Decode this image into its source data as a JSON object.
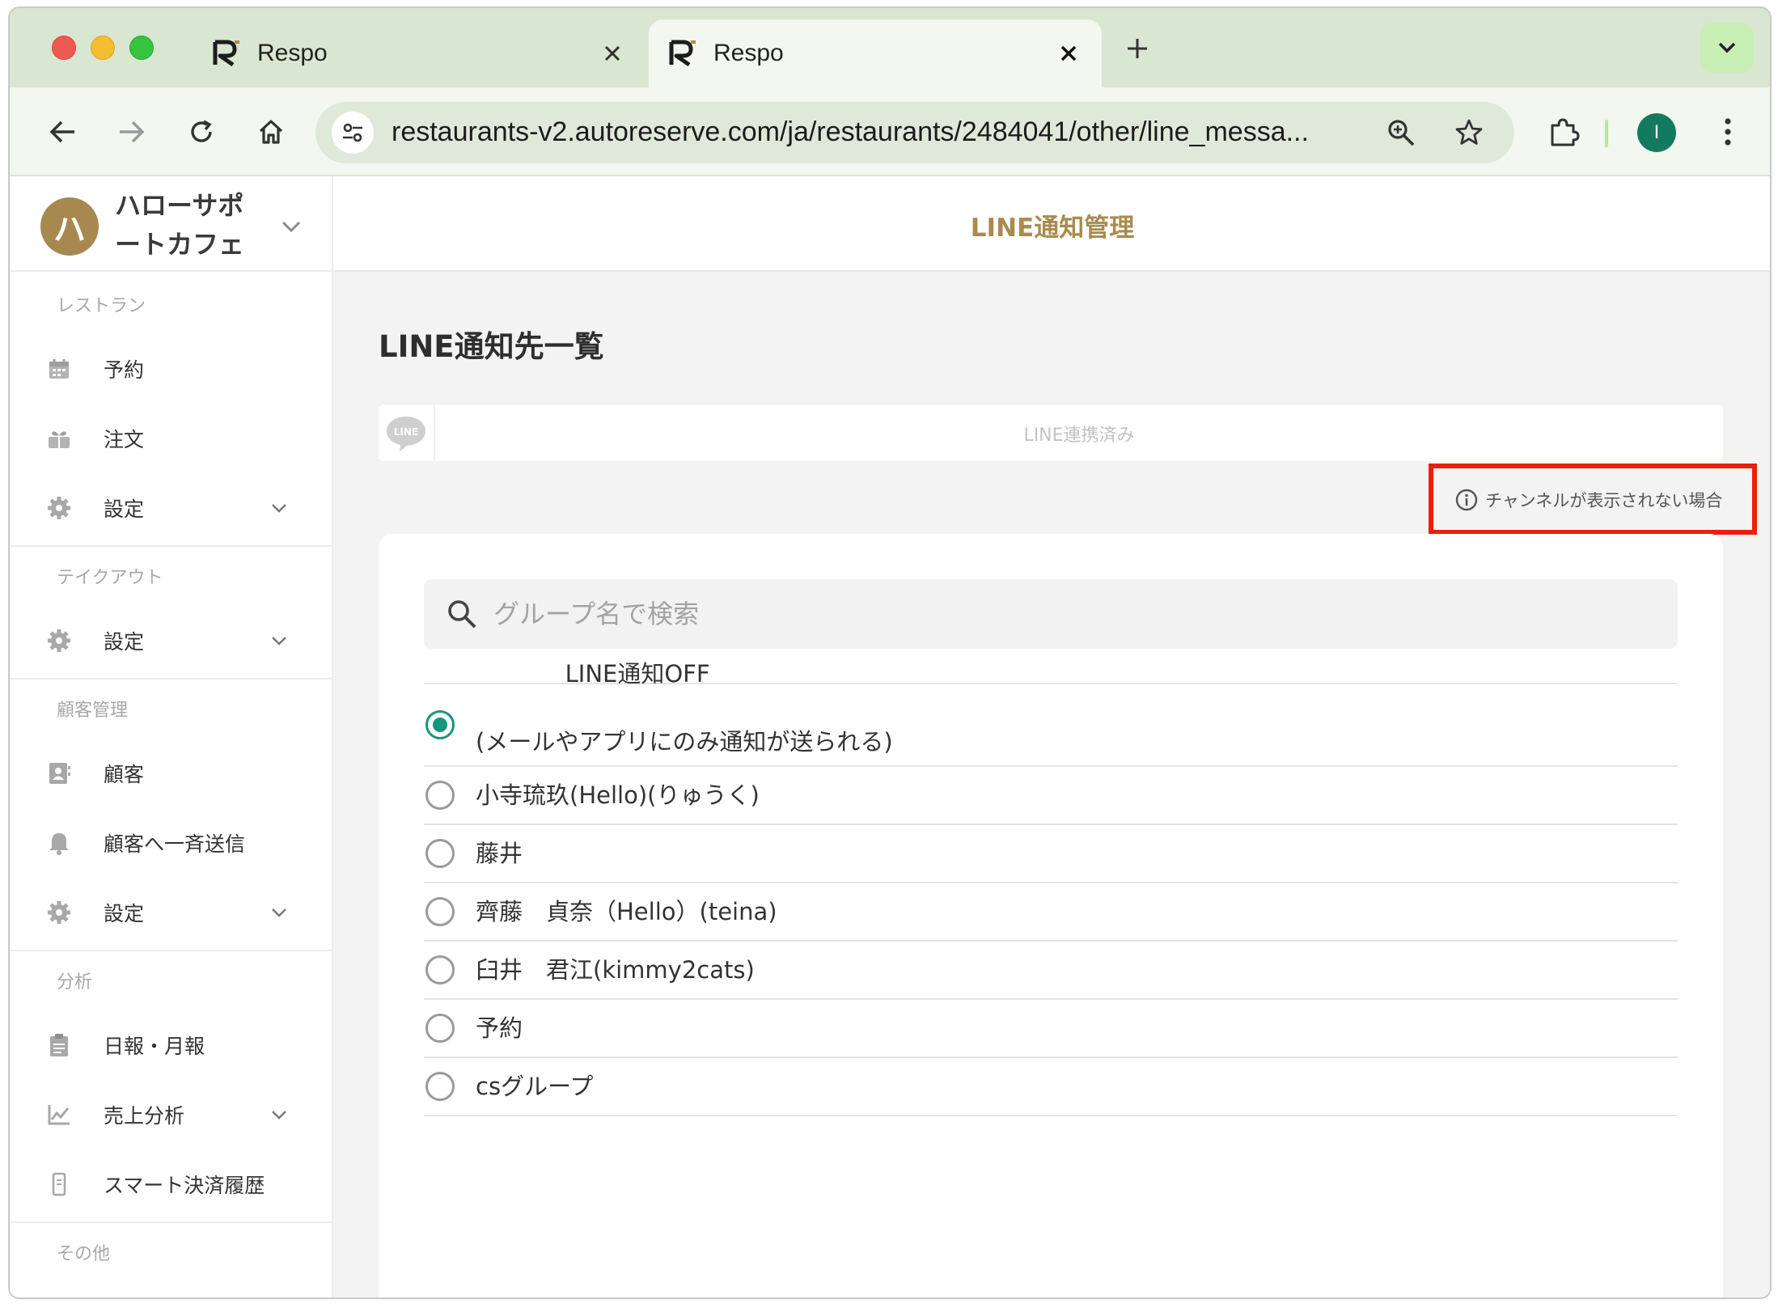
{
  "browser": {
    "tabs": [
      {
        "title": "Respo",
        "active": false
      },
      {
        "title": "Respo",
        "active": true
      }
    ],
    "url": "restaurants-v2.autoreserve.com/ja/restaurants/2484041/other/line_messa...",
    "profile_initial": "I"
  },
  "sidebar": {
    "store_avatar": "ハ",
    "store_name": "ハローサポートカフェ",
    "sections": [
      {
        "label": "レストラン",
        "items": [
          {
            "label": "予約",
            "icon": "calendar-icon"
          },
          {
            "label": "注文",
            "icon": "gift-icon"
          },
          {
            "label": "設定",
            "icon": "gear-icon",
            "has_chevron": true
          }
        ]
      },
      {
        "label": "テイクアウト",
        "items": [
          {
            "label": "設定",
            "icon": "gear-icon",
            "has_chevron": true
          }
        ]
      },
      {
        "label": "顧客管理",
        "items": [
          {
            "label": "顧客",
            "icon": "contact-book-icon"
          },
          {
            "label": "顧客へ一斉送信",
            "icon": "bell-icon"
          },
          {
            "label": "設定",
            "icon": "gear-icon",
            "has_chevron": true
          }
        ]
      },
      {
        "label": "分析",
        "items": [
          {
            "label": "日報・月報",
            "icon": "clipboard-icon"
          },
          {
            "label": "売上分析",
            "icon": "line-chart-icon",
            "has_chevron": true
          },
          {
            "label": "スマート決済履歴",
            "icon": "phone-receipt-icon"
          }
        ]
      },
      {
        "label": "その他",
        "items": []
      }
    ]
  },
  "main": {
    "header_title": "LINE通知管理",
    "page_title": "LINE通知先一覧",
    "line_logo_text": "LINE",
    "line_status": "LINE連携済み",
    "help_link": "チャンネルが表示されない場合",
    "search_placeholder": "グループ名で検索",
    "options": [
      {
        "label": "LINE通知OFF",
        "sublabel": "(メールやアプリにのみ通知が送られる)",
        "checked": true
      },
      {
        "label": "小寺琉玖(Hello)(りゅうく)",
        "checked": false
      },
      {
        "label": "藤井",
        "checked": false
      },
      {
        "label": "齊藤　貞奈（Hello）(teina)",
        "checked": false
      },
      {
        "label": "臼井　君江(kimmy2cats)",
        "checked": false
      },
      {
        "label": "予約",
        "checked": false
      },
      {
        "label": "csグループ",
        "checked": false
      }
    ]
  },
  "colors": {
    "accent_gold": "#a98b4e",
    "radio_green": "#14977a",
    "highlight_red": "#ee1d0c",
    "chrome_green": "#d9e6d1"
  }
}
